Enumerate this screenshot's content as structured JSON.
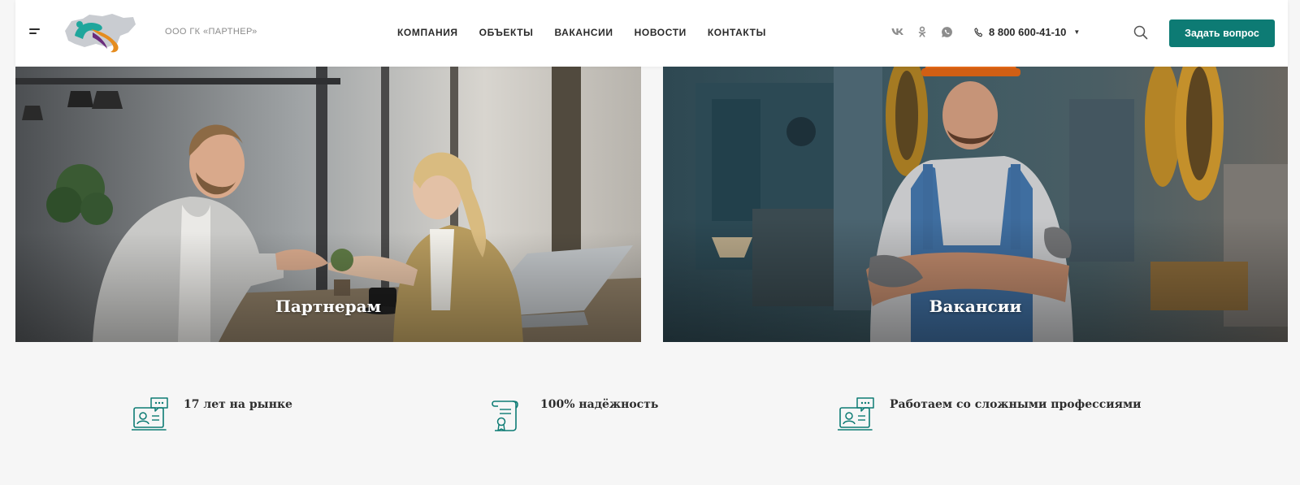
{
  "header": {
    "company_name": "ООО ГК «ПАРТНЕР»",
    "nav": [
      {
        "label": "КОМПАНИЯ"
      },
      {
        "label": "ОБЪЕКТЫ"
      },
      {
        "label": "ВАКАНСИИ"
      },
      {
        "label": "НОВОСТИ"
      },
      {
        "label": "КОНТАКТЫ"
      }
    ],
    "social_icons": [
      "vk-icon",
      "odnoklassniki-icon",
      "whatsapp-icon"
    ],
    "phone": "8 800 600-41-10",
    "ask_button": "Задать вопрос",
    "accent_color": "#0d7b74"
  },
  "cards": [
    {
      "title": "Партнерам",
      "icon": "handshake-photo"
    },
    {
      "title": "Вакансии",
      "icon": "worker-photo"
    }
  ],
  "features": [
    {
      "text": "17 лет на рынке",
      "icon": "online-consultant-icon"
    },
    {
      "text": "100% надёжность",
      "icon": "certificate-scroll-icon"
    },
    {
      "text": "Работаем со сложными профессиями",
      "icon": "online-consultant-icon"
    }
  ]
}
